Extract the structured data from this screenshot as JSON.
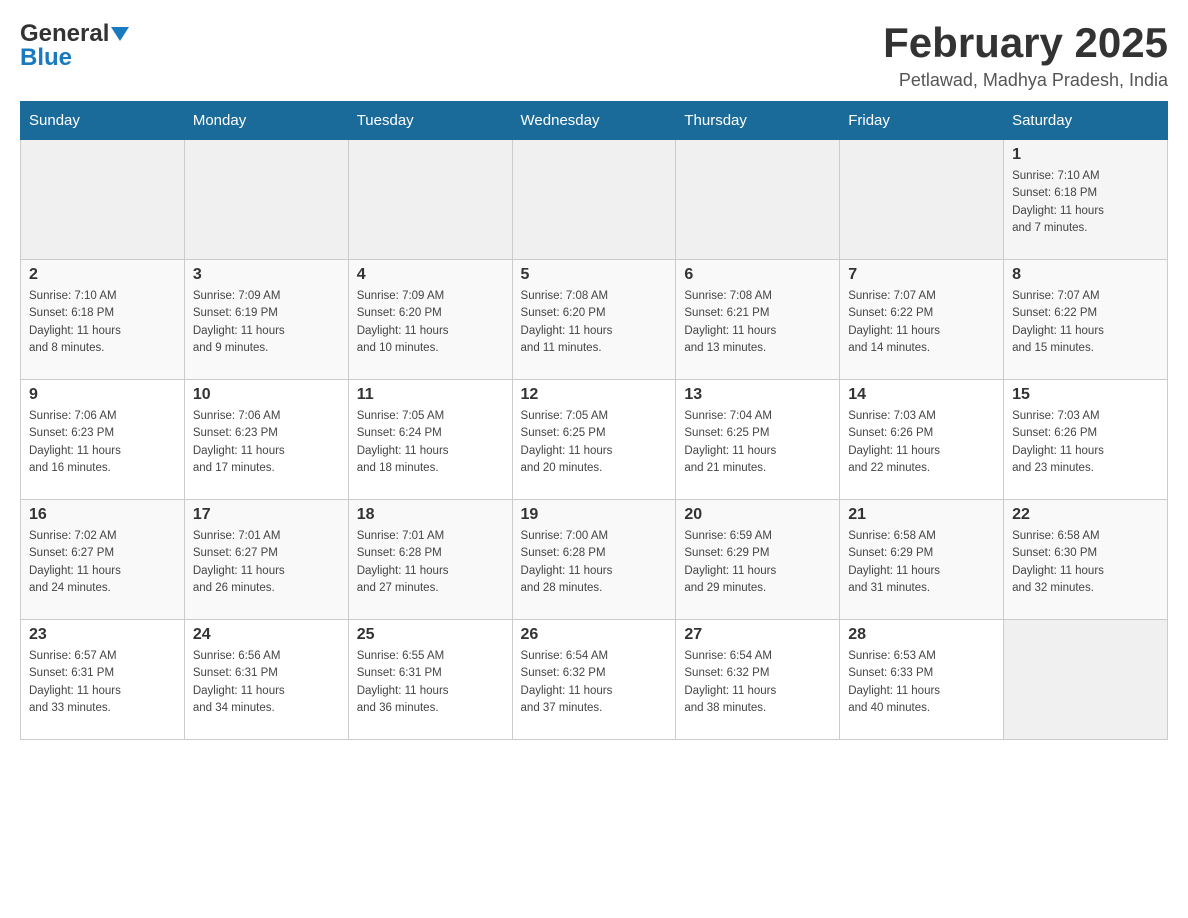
{
  "header": {
    "logo_general": "General",
    "logo_blue": "Blue",
    "month_title": "February 2025",
    "location": "Petlawad, Madhya Pradesh, India"
  },
  "weekdays": [
    "Sunday",
    "Monday",
    "Tuesday",
    "Wednesday",
    "Thursday",
    "Friday",
    "Saturday"
  ],
  "weeks": [
    [
      {
        "day": "",
        "info": ""
      },
      {
        "day": "",
        "info": ""
      },
      {
        "day": "",
        "info": ""
      },
      {
        "day": "",
        "info": ""
      },
      {
        "day": "",
        "info": ""
      },
      {
        "day": "",
        "info": ""
      },
      {
        "day": "1",
        "info": "Sunrise: 7:10 AM\nSunset: 6:18 PM\nDaylight: 11 hours\nand 7 minutes."
      }
    ],
    [
      {
        "day": "2",
        "info": "Sunrise: 7:10 AM\nSunset: 6:18 PM\nDaylight: 11 hours\nand 8 minutes."
      },
      {
        "day": "3",
        "info": "Sunrise: 7:09 AM\nSunset: 6:19 PM\nDaylight: 11 hours\nand 9 minutes."
      },
      {
        "day": "4",
        "info": "Sunrise: 7:09 AM\nSunset: 6:20 PM\nDaylight: 11 hours\nand 10 minutes."
      },
      {
        "day": "5",
        "info": "Sunrise: 7:08 AM\nSunset: 6:20 PM\nDaylight: 11 hours\nand 11 minutes."
      },
      {
        "day": "6",
        "info": "Sunrise: 7:08 AM\nSunset: 6:21 PM\nDaylight: 11 hours\nand 13 minutes."
      },
      {
        "day": "7",
        "info": "Sunrise: 7:07 AM\nSunset: 6:22 PM\nDaylight: 11 hours\nand 14 minutes."
      },
      {
        "day": "8",
        "info": "Sunrise: 7:07 AM\nSunset: 6:22 PM\nDaylight: 11 hours\nand 15 minutes."
      }
    ],
    [
      {
        "day": "9",
        "info": "Sunrise: 7:06 AM\nSunset: 6:23 PM\nDaylight: 11 hours\nand 16 minutes."
      },
      {
        "day": "10",
        "info": "Sunrise: 7:06 AM\nSunset: 6:23 PM\nDaylight: 11 hours\nand 17 minutes."
      },
      {
        "day": "11",
        "info": "Sunrise: 7:05 AM\nSunset: 6:24 PM\nDaylight: 11 hours\nand 18 minutes."
      },
      {
        "day": "12",
        "info": "Sunrise: 7:05 AM\nSunset: 6:25 PM\nDaylight: 11 hours\nand 20 minutes."
      },
      {
        "day": "13",
        "info": "Sunrise: 7:04 AM\nSunset: 6:25 PM\nDaylight: 11 hours\nand 21 minutes."
      },
      {
        "day": "14",
        "info": "Sunrise: 7:03 AM\nSunset: 6:26 PM\nDaylight: 11 hours\nand 22 minutes."
      },
      {
        "day": "15",
        "info": "Sunrise: 7:03 AM\nSunset: 6:26 PM\nDaylight: 11 hours\nand 23 minutes."
      }
    ],
    [
      {
        "day": "16",
        "info": "Sunrise: 7:02 AM\nSunset: 6:27 PM\nDaylight: 11 hours\nand 24 minutes."
      },
      {
        "day": "17",
        "info": "Sunrise: 7:01 AM\nSunset: 6:27 PM\nDaylight: 11 hours\nand 26 minutes."
      },
      {
        "day": "18",
        "info": "Sunrise: 7:01 AM\nSunset: 6:28 PM\nDaylight: 11 hours\nand 27 minutes."
      },
      {
        "day": "19",
        "info": "Sunrise: 7:00 AM\nSunset: 6:28 PM\nDaylight: 11 hours\nand 28 minutes."
      },
      {
        "day": "20",
        "info": "Sunrise: 6:59 AM\nSunset: 6:29 PM\nDaylight: 11 hours\nand 29 minutes."
      },
      {
        "day": "21",
        "info": "Sunrise: 6:58 AM\nSunset: 6:29 PM\nDaylight: 11 hours\nand 31 minutes."
      },
      {
        "day": "22",
        "info": "Sunrise: 6:58 AM\nSunset: 6:30 PM\nDaylight: 11 hours\nand 32 minutes."
      }
    ],
    [
      {
        "day": "23",
        "info": "Sunrise: 6:57 AM\nSunset: 6:31 PM\nDaylight: 11 hours\nand 33 minutes."
      },
      {
        "day": "24",
        "info": "Sunrise: 6:56 AM\nSunset: 6:31 PM\nDaylight: 11 hours\nand 34 minutes."
      },
      {
        "day": "25",
        "info": "Sunrise: 6:55 AM\nSunset: 6:31 PM\nDaylight: 11 hours\nand 36 minutes."
      },
      {
        "day": "26",
        "info": "Sunrise: 6:54 AM\nSunset: 6:32 PM\nDaylight: 11 hours\nand 37 minutes."
      },
      {
        "day": "27",
        "info": "Sunrise: 6:54 AM\nSunset: 6:32 PM\nDaylight: 11 hours\nand 38 minutes."
      },
      {
        "day": "28",
        "info": "Sunrise: 6:53 AM\nSunset: 6:33 PM\nDaylight: 11 hours\nand 40 minutes."
      },
      {
        "day": "",
        "info": ""
      }
    ]
  ]
}
